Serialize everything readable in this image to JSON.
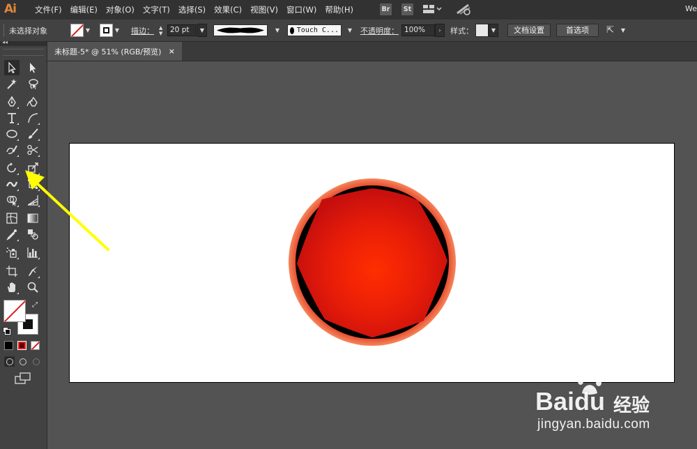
{
  "app": {
    "logo": "Ai",
    "window_label": "We"
  },
  "menu": [
    "文件(F)",
    "编辑(E)",
    "对象(O)",
    "文字(T)",
    "选择(S)",
    "效果(C)",
    "视图(V)",
    "窗口(W)",
    "帮助(H)"
  ],
  "menu_badges": {
    "bridge": "Br",
    "stock": "St"
  },
  "control_bar": {
    "selection_status": "未选择对象",
    "stroke_label": "描边：",
    "stroke_weight": "20 pt",
    "brush_name": "Touch C...",
    "opacity_label": "不透明度：",
    "opacity_value": "100%",
    "style_label": "样式：",
    "doc_setup_button": "文档设置",
    "preferences_button": "首选项"
  },
  "document_tab": {
    "title": "未标题-5* @ 51% (RGB/预览)",
    "close_glyph": "×"
  },
  "colors": {
    "circle_outer": "#f0673a",
    "circle_center": "#ff2a00",
    "circle_edge": "#c50e0e",
    "annotation_arrow": "#ffff00"
  },
  "watermark": {
    "brand": "Bai",
    "brand_suffix": "du",
    "product": "经验",
    "url": "jingyan.baidu.com"
  }
}
